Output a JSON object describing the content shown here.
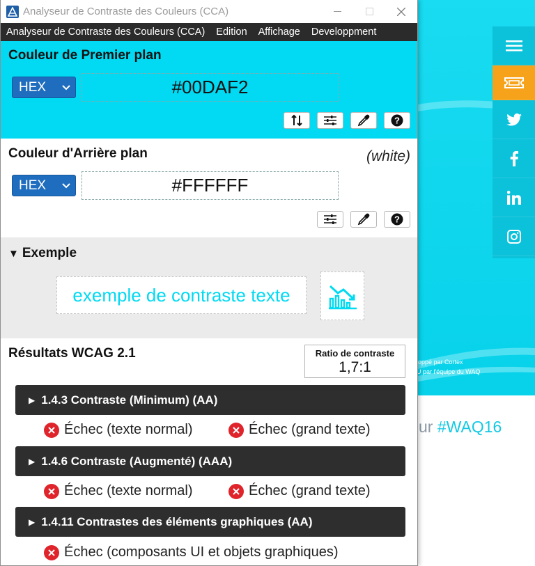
{
  "window": {
    "title": "Analyseur de Contraste des Couleurs (CCA)"
  },
  "menu": {
    "items": [
      "Analyseur de Contraste des Couleurs (CCA)",
      "Edition",
      "Affichage",
      "Developpment"
    ]
  },
  "foreground": {
    "title": "Couleur de Premier plan",
    "format": "HEX",
    "value": "#00DAF2",
    "color": "#00DAF2"
  },
  "background": {
    "title": "Couleur d'Arrière plan",
    "name": "(white)",
    "format": "HEX",
    "value": "#FFFFFF",
    "color": "#FFFFFF"
  },
  "example": {
    "title": "Exemple",
    "sample_text": "exemple de contraste texte",
    "graphic_icon": "chart-graphic-icon"
  },
  "results": {
    "title": "Résultats WCAG 2.1",
    "ratio_label": "Ratio de contraste",
    "ratio_value": "1,7:1",
    "criteria": [
      {
        "label": "1.4.3 Contraste (Minimum) (AA)",
        "outcomes": [
          "Échec (texte normal)",
          "Échec (grand texte)"
        ]
      },
      {
        "label": "1.4.6 Contraste (Augmenté) (AAA)",
        "outcomes": [
          "Échec (texte normal)",
          "Échec (grand texte)"
        ]
      },
      {
        "label": "1.4.11 Contrastes des éléments graphiques (AA)",
        "outcomes": [
          "Échec (composants UI et objets graphiques)"
        ]
      }
    ],
    "fail_color": "#E0242B"
  },
  "website": {
    "credit_line1": "loppé par Cortex",
    "credit_line2": "U par l'équipe du WAQ",
    "hashtag_prefix": "ur ",
    "hashtag": "#WAQ16",
    "accent": "#F7A21B"
  }
}
